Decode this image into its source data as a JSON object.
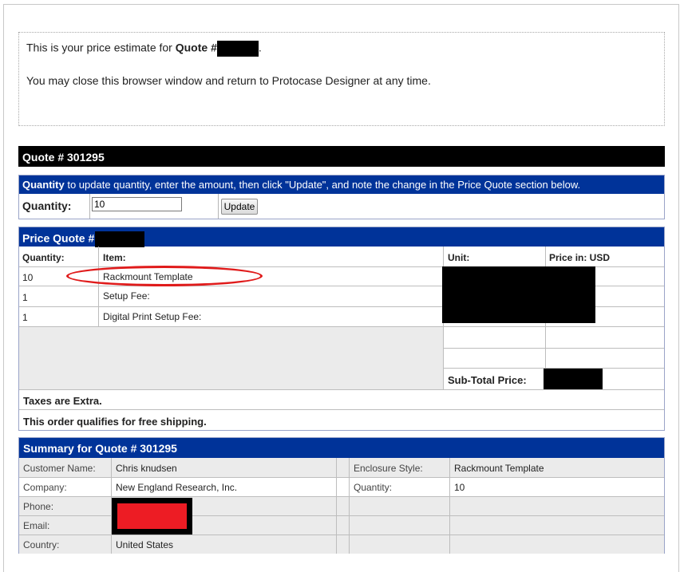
{
  "intro": {
    "line1_prefix": "This is your price estimate for ",
    "line1_bold": "Quote #",
    "line1_suffix": ".",
    "line2": "You may close this browser window and return to Protocase Designer at any time."
  },
  "quote_bar": {
    "title": "Quote # 301295"
  },
  "quantity_section": {
    "head_bold": "Quantity",
    "head_text": " to update quantity, enter the amount, then click \"Update\", and note the change in the Price Quote section below.",
    "label": "Quantity:",
    "value": "10",
    "update_label": "Update"
  },
  "price_quote": {
    "title": "Price Quote #",
    "columns": {
      "quantity": "Quantity:",
      "item": "Item:",
      "unit": "Unit:",
      "price": "Price in: USD"
    },
    "rows": [
      {
        "qty": "10",
        "item": "Rackmount Template"
      },
      {
        "qty": "1",
        "item": "Setup Fee:"
      },
      {
        "qty": "1",
        "item": "Digital Print Setup Fee:"
      }
    ],
    "subtotal_label": "Sub-Total Price:",
    "taxes": "Taxes are Extra.",
    "shipping": "This order qualifies for free shipping."
  },
  "summary": {
    "title": "Summary for Quote # 301295",
    "left": [
      {
        "label": "Customer Name:",
        "value": "Chris knudsen"
      },
      {
        "label": "Company:",
        "value": "New England Research, Inc."
      },
      {
        "label": "Phone:",
        "value": ""
      },
      {
        "label": "Email:",
        "value": ""
      },
      {
        "label": "Country:",
        "value": "United States"
      }
    ],
    "right": [
      {
        "label": "Enclosure Style:",
        "value": "Rackmount Template"
      },
      {
        "label": "Quantity:",
        "value": "10"
      }
    ]
  },
  "colors": {
    "header_blue": "#003399",
    "annotation_red": "#e01b1b",
    "row_gray": "#ebebeb"
  }
}
